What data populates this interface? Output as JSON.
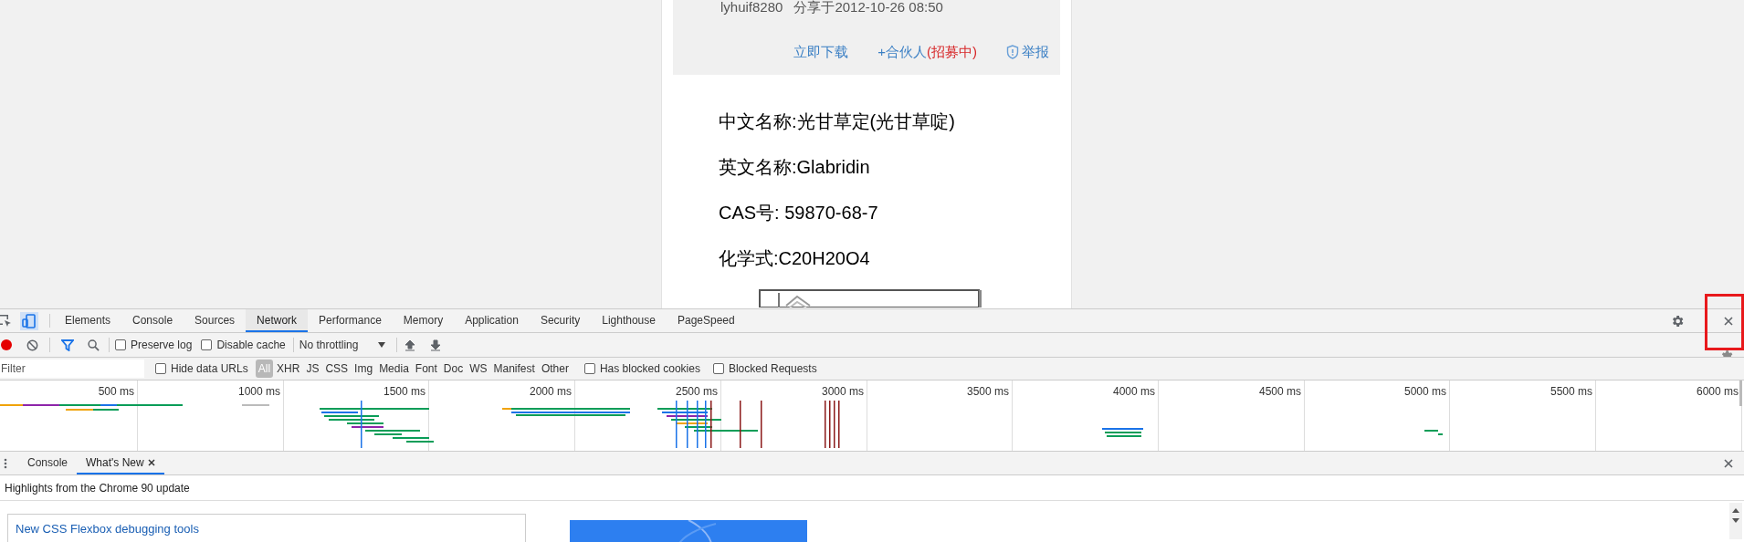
{
  "article": {
    "author": "lyhuif8280",
    "shared": "分享于2012-10-26 08:50",
    "actions": [
      {
        "kind": "download",
        "text": "立即下载"
      },
      {
        "kind": "partner",
        "text": "+合伙人",
        "badge": "(招募中)"
      },
      {
        "kind": "report",
        "text": "举报"
      }
    ],
    "lines": [
      "中文名称:光甘草定(光甘草啶)",
      "英文名称:Glabridin",
      "CAS号: 59870-68-7",
      "化学式:C20H20O4"
    ]
  },
  "devtools": {
    "tabs": [
      {
        "label": "Elements",
        "selected": false
      },
      {
        "label": "Console",
        "selected": false
      },
      {
        "label": "Sources",
        "selected": false
      },
      {
        "label": "Network",
        "selected": true
      },
      {
        "label": "Performance",
        "selected": false
      },
      {
        "label": "Memory",
        "selected": false
      },
      {
        "label": "Application",
        "selected": false
      },
      {
        "label": "Security",
        "selected": false
      },
      {
        "label": "Lighthouse",
        "selected": false
      },
      {
        "label": "PageSpeed",
        "selected": false
      }
    ],
    "toolbar": {
      "recording": true,
      "filter_active": true,
      "checks": [
        {
          "label": "Preserve log",
          "checked": false
        },
        {
          "label": "Disable cache",
          "checked": false
        }
      ],
      "throttling": "No throttling"
    },
    "filter": {
      "placeholder": "Filter",
      "hide_data_urls": {
        "label": "Hide data URLs",
        "checked": false
      },
      "types": [
        {
          "label": "All",
          "selected": true
        },
        {
          "label": "XHR",
          "selected": false
        },
        {
          "label": "JS",
          "selected": false
        },
        {
          "label": "CSS",
          "selected": false
        },
        {
          "label": "Img",
          "selected": false
        },
        {
          "label": "Media",
          "selected": false
        },
        {
          "label": "Font",
          "selected": false
        },
        {
          "label": "Doc",
          "selected": false
        },
        {
          "label": "WS",
          "selected": false
        },
        {
          "label": "Manifest",
          "selected": false
        },
        {
          "label": "Other",
          "selected": false
        }
      ],
      "extra_checks": [
        {
          "label": "Has blocked cookies",
          "checked": false
        },
        {
          "label": "Blocked Requests",
          "checked": false
        }
      ]
    },
    "timeline": {
      "ticks": [
        "500 ms",
        "1000 ms",
        "1500 ms",
        "2000 ms",
        "2500 ms",
        "3000 ms",
        "3500 ms",
        "4000 ms",
        "4500 ms",
        "5000 ms",
        "5500 ms",
        "6000 ms"
      ]
    },
    "drawer": {
      "tabs": [
        {
          "label": "Console",
          "selected": false,
          "closable": false
        },
        {
          "label": "What's New",
          "selected": true,
          "closable": true
        }
      ],
      "headline": "Highlights from the Chrome 90 update",
      "card_title": "New CSS Flexbox debugging tools"
    }
  }
}
